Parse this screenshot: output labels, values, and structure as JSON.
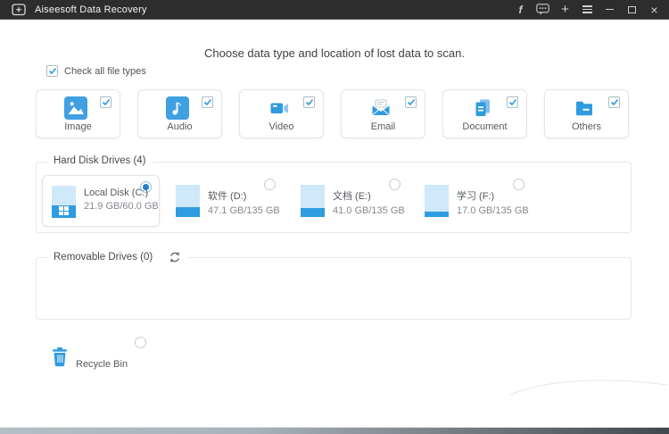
{
  "colors": {
    "accent": "#2f9be0",
    "titlebar_bg": "#2d2d2d",
    "icon_blue": "#41a0e1"
  },
  "titlebar": {
    "title": "Aiseesoft Data Recovery",
    "facebook_glyph": "f",
    "plus_glyph": "+",
    "close_glyph": "×"
  },
  "header": {
    "title": "Choose data type and location of lost data to scan."
  },
  "check_all": {
    "label": "Check all file types",
    "checked": true
  },
  "file_types": [
    {
      "label": "Image",
      "checked": true
    },
    {
      "label": "Audio",
      "checked": true
    },
    {
      "label": "Video",
      "checked": true
    },
    {
      "label": "Email",
      "checked": true
    },
    {
      "label": "Document",
      "checked": true
    },
    {
      "label": "Others",
      "checked": true
    }
  ],
  "hard_disk_drives": {
    "legend": "Hard Disk Drives (4)",
    "drives": [
      {
        "name": "Local Disk (C:)",
        "size": "21.9 GB/60.0 GB",
        "selected": true
      },
      {
        "name": "软件 (D:)",
        "size": "47.1 GB/135 GB",
        "selected": false
      },
      {
        "name": "文档 (E:)",
        "size": "41.0 GB/135 GB",
        "selected": false
      },
      {
        "name": "学习 (F:)",
        "size": "17.0 GB/135 GB",
        "selected": false
      }
    ]
  },
  "removable_drives": {
    "legend": "Removable Drives (0)"
  },
  "recycle_bin": {
    "label": "Recycle Bin",
    "selected": false
  }
}
